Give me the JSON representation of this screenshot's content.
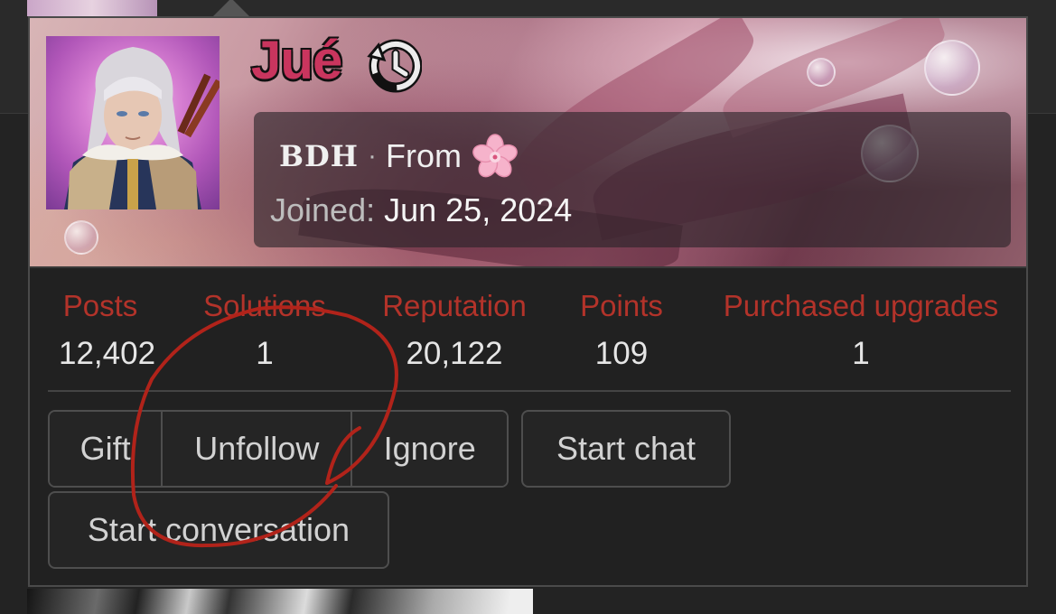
{
  "profile": {
    "username": "Jué",
    "title_prefix": "BDH",
    "title_separator": "·",
    "from_text": "From",
    "joined_label": "Joined:",
    "joined_date": "Jun 25, 2024"
  },
  "stats": [
    {
      "label": "Posts",
      "value": "12,402"
    },
    {
      "label": "Solutions",
      "value": "1"
    },
    {
      "label": "Reputation",
      "value": "20,122"
    },
    {
      "label": "Points",
      "value": "109"
    },
    {
      "label": "Purchased upgrades",
      "value": "1"
    }
  ],
  "actions": {
    "gift": "Gift",
    "unfollow": "Unfollow",
    "ignore": "Ignore",
    "start_chat": "Start chat",
    "start_conversation": "Start conversation"
  },
  "colors": {
    "username": "#c9355e",
    "stat_label": "#b3332a",
    "card_background": "#212121",
    "annotation": "#b1231a"
  },
  "icons": [
    "history-icon",
    "cherry-blossom-icon"
  ]
}
